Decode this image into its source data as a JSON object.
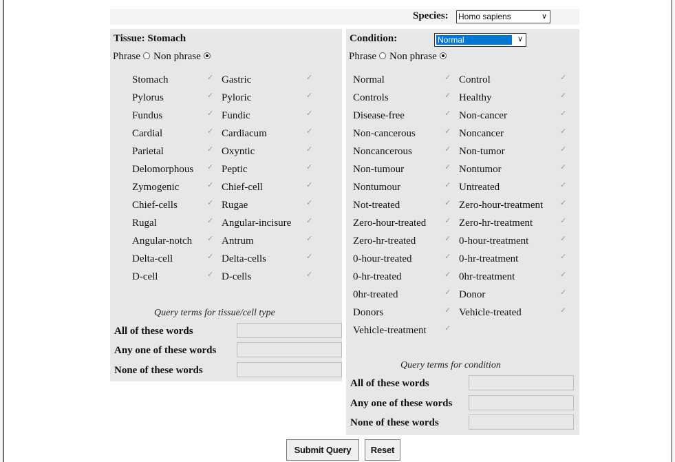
{
  "species": {
    "label": "Species:",
    "selected": "Homo sapiens"
  },
  "tissue": {
    "title": "Tissue: Stomach",
    "phrase_label": "Phrase",
    "non_phrase_label": "Non phrase",
    "selected_mode": "Non phrase",
    "terms": [
      [
        "Stomach",
        "Gastric"
      ],
      [
        "Pylorus",
        "Pyloric"
      ],
      [
        "Fundus",
        "Fundic"
      ],
      [
        "Cardial",
        "Cardiacum"
      ],
      [
        "Parietal",
        "Oxyntic"
      ],
      [
        "Delomorphous",
        "Peptic"
      ],
      [
        "Zymogenic",
        "Chief-cell"
      ],
      [
        "Chief-cells",
        "Rugae"
      ],
      [
        "Rugal",
        "Angular-incisure"
      ],
      [
        "Angular-notch",
        "Antrum"
      ],
      [
        "Delta-cell",
        "Delta-cells"
      ],
      [
        "D-cell",
        "D-cells"
      ]
    ],
    "query_title": "Query terms for tissue/cell type",
    "query_labels": [
      "All of these words",
      "Any one of these words",
      "None of these words"
    ]
  },
  "condition": {
    "title": "Condition:",
    "selected": "Normal",
    "phrase_label": "Phrase",
    "non_phrase_label": "Non phrase",
    "selected_mode": "Non phrase",
    "terms": [
      [
        "Normal",
        "Control"
      ],
      [
        "Controls",
        "Healthy"
      ],
      [
        "Disease-free",
        "Non-cancer"
      ],
      [
        "Non-cancerous",
        "Noncancer"
      ],
      [
        "Noncancerous",
        "Non-tumor"
      ],
      [
        "Non-tumour",
        "Nontumor"
      ],
      [
        "Nontumour",
        "Untreated"
      ],
      [
        "Not-treated",
        "Zero-hour-treatment"
      ],
      [
        "Zero-hour-treated",
        "Zero-hr-treatment"
      ],
      [
        "Zero-hr-treated",
        "0-hour-treatment"
      ],
      [
        "0-hour-treated",
        "0-hr-treatment"
      ],
      [
        "0-hr-treated",
        "0hr-treatment"
      ],
      [
        "0hr-treated",
        "Donor"
      ],
      [
        "Donors",
        "Vehicle-treated"
      ],
      [
        "Vehicle-treatment",
        null
      ]
    ],
    "query_title": "Query terms for condition",
    "query_labels": [
      "All of these words",
      "Any one of these words",
      "None of these words"
    ]
  },
  "buttons": {
    "submit": "Submit Query",
    "reset": "Reset"
  }
}
